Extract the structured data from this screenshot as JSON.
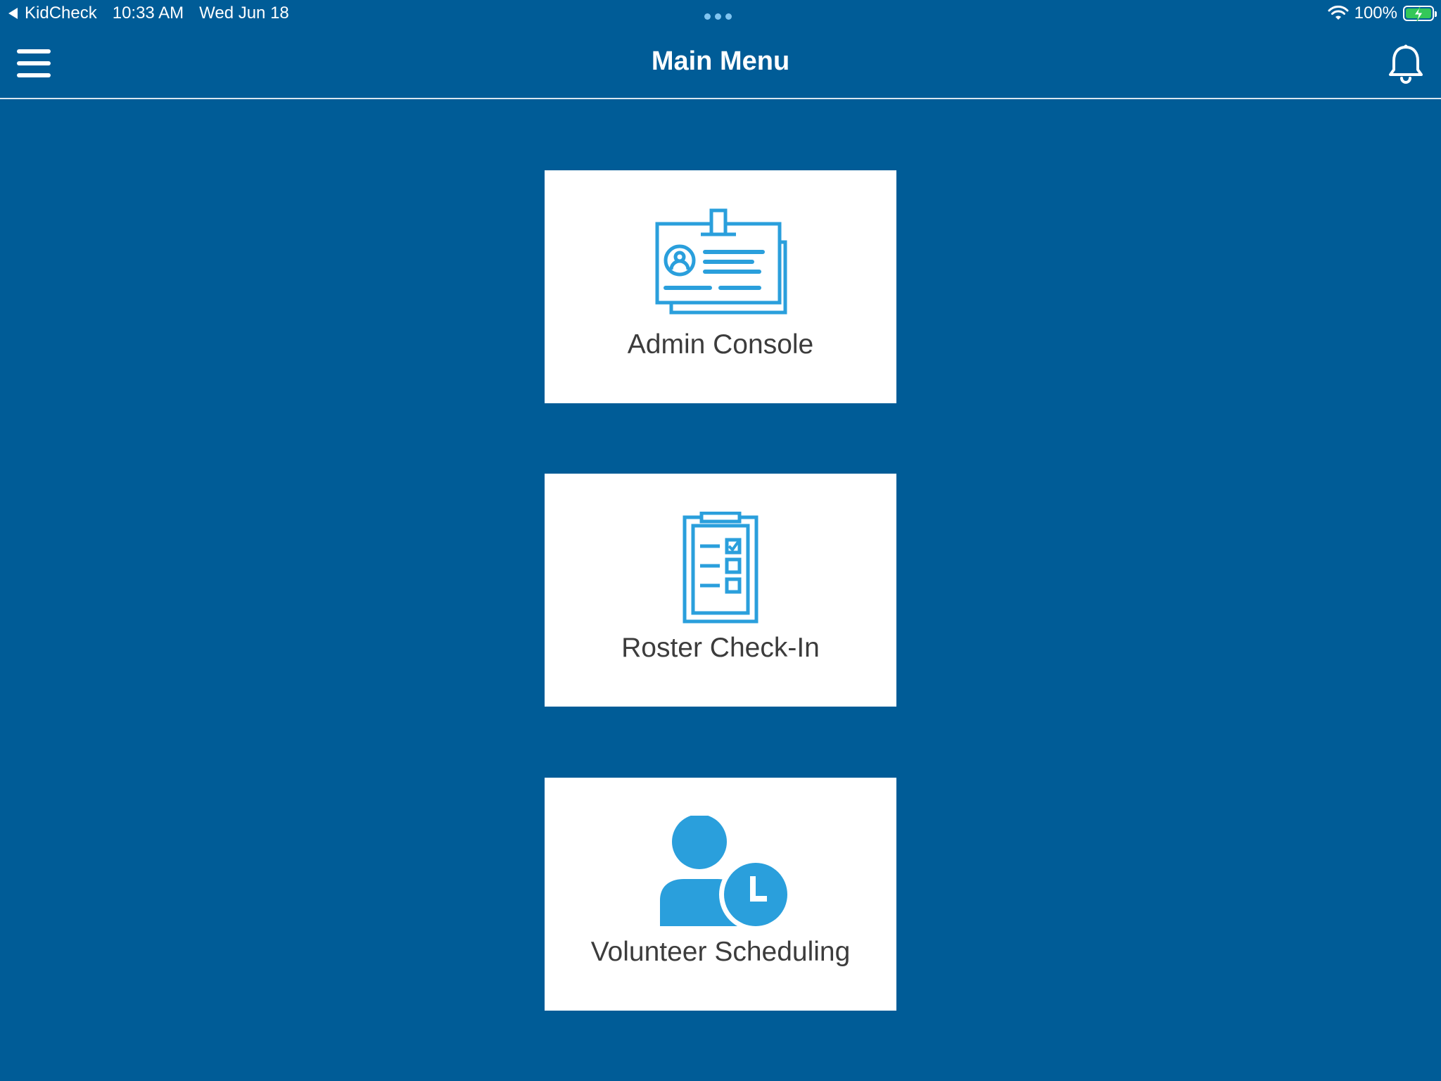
{
  "status_bar": {
    "back_app": "KidCheck",
    "time": "10:33 AM",
    "date": "Wed Jun 18",
    "battery": "100%",
    "battery_level": 1.0
  },
  "nav": {
    "title": "Main Menu",
    "menu_icon": "hamburger-menu-icon",
    "notification_icon": "bell-icon"
  },
  "menu_items": [
    {
      "label": "Admin Console",
      "icon": "id-badge-icon"
    },
    {
      "label": "Roster Check-In",
      "icon": "clipboard-checklist-icon"
    },
    {
      "label": "Volunteer Scheduling",
      "icon": "user-clock-icon"
    }
  ],
  "colors": {
    "background": "#005c97",
    "card": "#ffffff",
    "icon": "#2a9fdc",
    "card_text": "#3c3c3c",
    "battery": "#34c759"
  }
}
